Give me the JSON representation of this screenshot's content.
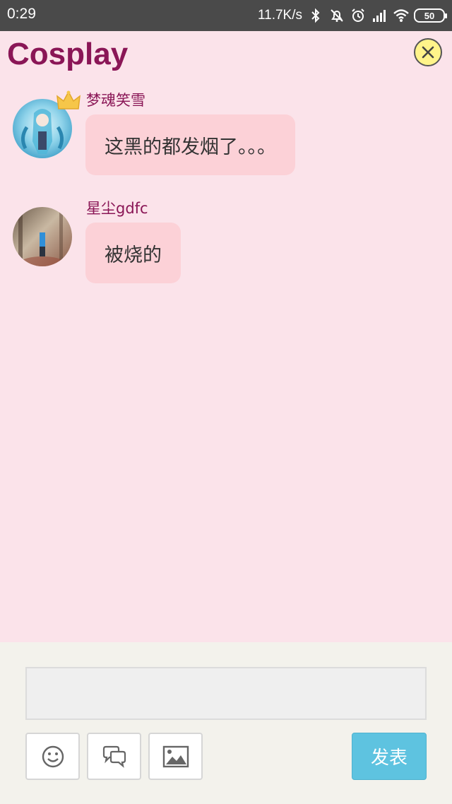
{
  "status_bar": {
    "time": "0:29",
    "network_speed": "11.7K/s",
    "battery_level": "50",
    "icons": [
      "bluetooth-icon",
      "mute-bell-icon",
      "alarm-icon",
      "signal-icon",
      "wifi-icon",
      "battery-icon"
    ]
  },
  "header": {
    "title": "Cosplay",
    "close_icon": "close-icon"
  },
  "messages": [
    {
      "username": "梦魂笑雪",
      "text": "这黑的都发烟了。。。",
      "has_crown": true
    },
    {
      "username": "星尘gdfc",
      "text": "被烧的",
      "has_crown": false
    }
  ],
  "composer": {
    "input_value": "",
    "tools": [
      "emoji-icon",
      "chat-bubbles-icon",
      "image-icon"
    ],
    "post_label": "发表"
  },
  "colors": {
    "background": "#fbe3ea",
    "title": "#8a1656",
    "bubble": "#fcd1d7",
    "post_button": "#5ec3e0",
    "composer_bg": "#f3f2ec"
  }
}
